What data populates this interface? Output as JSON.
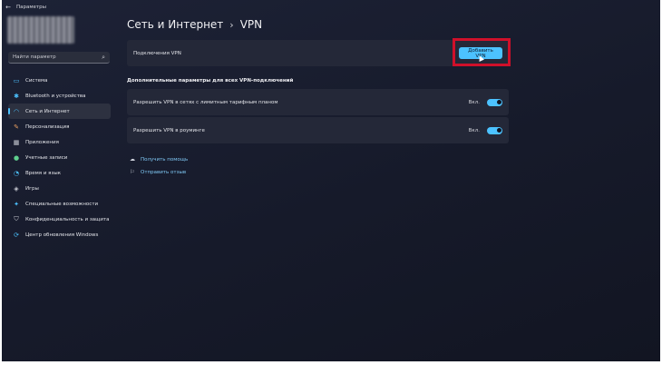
{
  "window": {
    "title": "Параметры"
  },
  "search": {
    "placeholder": "Найти параметр"
  },
  "sidebar": {
    "items": [
      {
        "label": "Система",
        "icon": "monitor-icon",
        "active": false
      },
      {
        "label": "Bluetooth и устройства",
        "icon": "bluetooth-icon",
        "active": false
      },
      {
        "label": "Сеть и Интернет",
        "icon": "wifi-icon",
        "active": true
      },
      {
        "label": "Персонализация",
        "icon": "brush-icon",
        "active": false
      },
      {
        "label": "Приложения",
        "icon": "apps-icon",
        "active": false
      },
      {
        "label": "Учетные записи",
        "icon": "person-icon",
        "active": false
      },
      {
        "label": "Время и язык",
        "icon": "globe-clock-icon",
        "active": false
      },
      {
        "label": "Игры",
        "icon": "gamepad-icon",
        "active": false
      },
      {
        "label": "Специальные возможности",
        "icon": "accessibility-icon",
        "active": false
      },
      {
        "label": "Конфиденциальность и защита",
        "icon": "shield-icon",
        "active": false
      },
      {
        "label": "Центр обновления Windows",
        "icon": "update-icon",
        "active": false
      }
    ]
  },
  "header": {
    "parent": "Сеть и Интернет",
    "separator": "›",
    "current": "VPN"
  },
  "vpn": {
    "connections_label": "Подключения VPN",
    "add_button": "Добавить VPN"
  },
  "advanced": {
    "title": "Дополнительные параметры для всех VPN-подключений",
    "metered": {
      "label": "Разрешить VPN в сетях с лимитным тарифным планом",
      "state": "Вкл.",
      "on": true
    },
    "roaming": {
      "label": "Разрешить VPN в роуминге",
      "state": "Вкл.",
      "on": true
    }
  },
  "links": {
    "help": "Получить помощь",
    "feedback": "Отправить отзыв"
  },
  "colors": {
    "accent": "#4cc2ff",
    "highlight": "#d0102a"
  }
}
